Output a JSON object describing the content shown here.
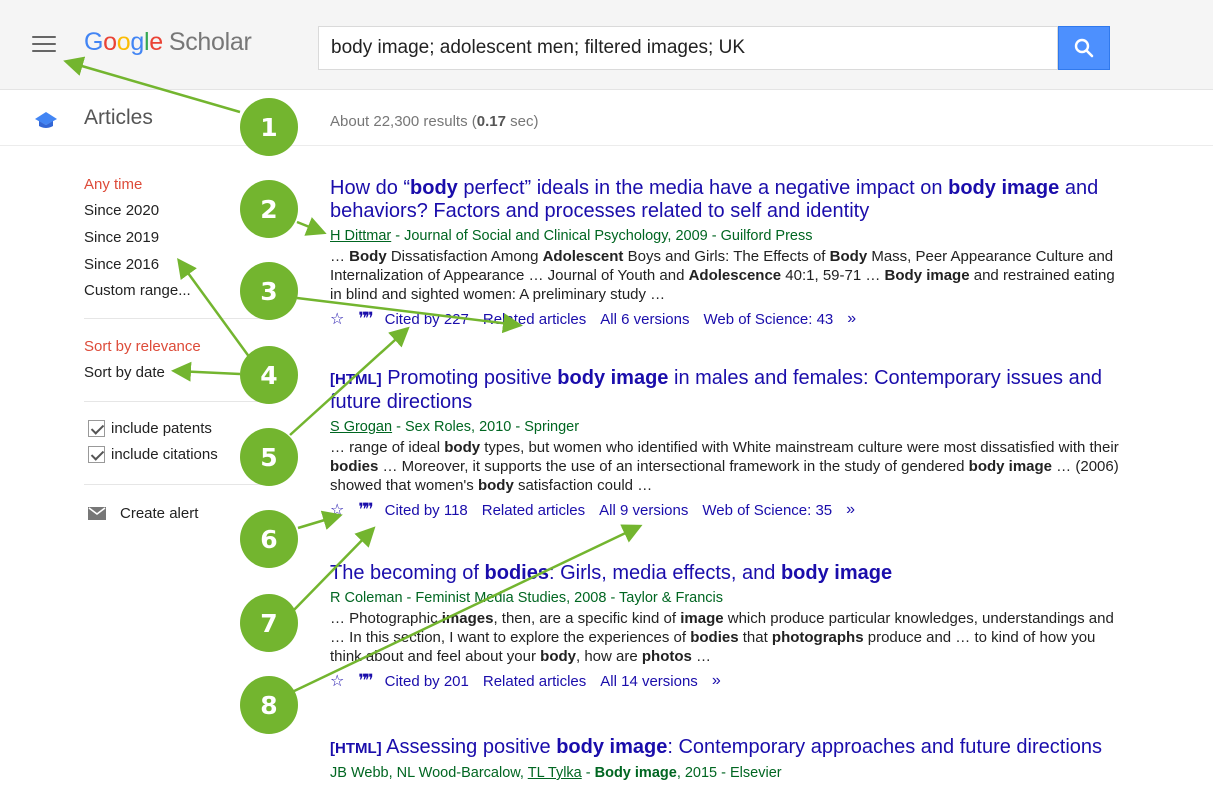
{
  "header": {
    "logo_google": [
      "G",
      "o",
      "o",
      "g",
      "l",
      "e"
    ],
    "logo_scholar": "Scholar",
    "search_query": "body image; adolescent men; filtered images; UK"
  },
  "articles_label": "Articles",
  "results_count": {
    "prefix": "About 22,300 results (",
    "time": "0.17",
    "suffix": " sec)"
  },
  "sidebar": {
    "time_filters": [
      "Any time",
      "Since 2020",
      "Since 2019",
      "Since 2016",
      "Custom range..."
    ],
    "sort_options": [
      "Sort by relevance",
      "Sort by date"
    ],
    "checkboxes": [
      "include patents",
      "include citations"
    ],
    "create_alert": "Create alert"
  },
  "results": [
    {
      "title_parts": [
        "How do “",
        "body",
        " perfect” ideals in the media have a negative impact on ",
        "body",
        " ",
        "image",
        " and behaviors? Factors and processes related to self and identity"
      ],
      "author_link": "H Dittmar",
      "author_rest": " - Journal of Social and Clinical Psychology, 2009 - Guilford Press",
      "snippet": [
        "… ",
        "Body",
        " Dissatisfaction Among ",
        "Adolescent",
        " Boys and Girls: The Effects of ",
        "Body",
        " Mass, Peer Appearance Culture and Internalization of Appearance … Journal of Youth and ",
        "Adolescence",
        " 40:1, 59-71 … ",
        "Body image",
        " and restrained eating in blind and sighted women: A preliminary study …"
      ],
      "cited": "Cited by 227",
      "related": "Related articles",
      "versions": "All 6 versions",
      "wos": "Web of Science: 43"
    },
    {
      "tag": "[HTML]",
      "title_parts": [
        " Promoting positive ",
        "body image",
        " in males and females: Contemporary issues and future directions"
      ],
      "author_link": "S Grogan",
      "author_rest": " - Sex Roles, 2010 - Springer",
      "snippet": [
        "… range of ideal ",
        "body",
        " types, but women who identified with White mainstream culture were most dissatisfied with their ",
        "bodies",
        " … Moreover, it supports the use of an intersectional framework in the study of gendered ",
        "body image",
        " … (2006) showed that women's ",
        "body",
        " satisfaction could …"
      ],
      "cited": "Cited by 118",
      "related": "Related articles",
      "versions": "All 9 versions",
      "wos": "Web of Science: 35"
    },
    {
      "title_parts": [
        "The becoming of ",
        "bodies",
        ": Girls, media effects, and ",
        "body image",
        ""
      ],
      "author_plain": "R Coleman - Feminist Media Studies, 2008 - Taylor & Francis",
      "snippet": [
        "… Photographic ",
        "images",
        ", then, are a specific kind of ",
        "image",
        " which produce particular knowledges, understandings and … In this section, I want to explore the experiences of ",
        "bodies",
        " that ",
        "photographs",
        " produce and … to kind of how you think about and feel about your ",
        "body",
        ", how are ",
        "photos",
        " …"
      ],
      "cited": "Cited by 201",
      "related": "Related articles",
      "versions": "All 14 versions"
    },
    {
      "tag": "[HTML]",
      "title_parts": [
        " Assessing positive ",
        "body image",
        ": Contemporary approaches and future directions"
      ],
      "author_pre": "JB Webb, NL Wood-Barcalow, ",
      "author_link": "TL Tylka",
      "author_mid": " - ",
      "author_bold": "Body image",
      "author_rest": ", 2015 - Elsevier"
    }
  ],
  "badges": [
    "1",
    "2",
    "3",
    "4",
    "5",
    "6",
    "7",
    "8"
  ],
  "colors": {
    "accent_green": "#73b52f",
    "link_blue": "#1a0dab",
    "author_green": "#006621",
    "filter_red": "#dd4b39",
    "search_blue": "#4d90fe"
  }
}
